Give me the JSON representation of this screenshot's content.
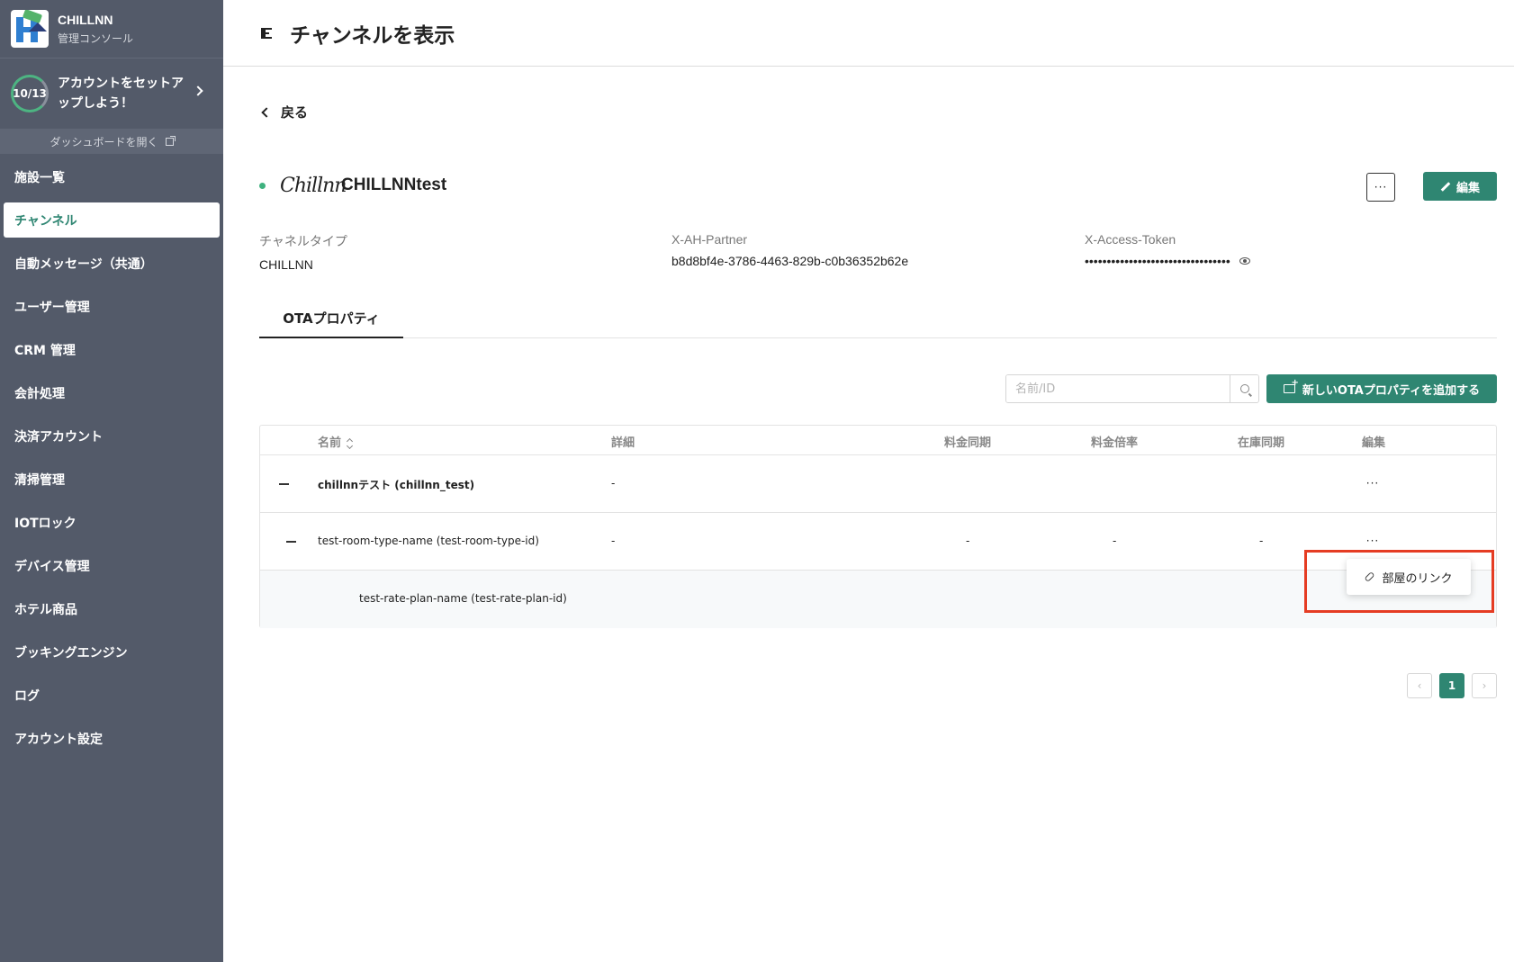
{
  "brand": {
    "name": "CHILLNN",
    "subtitle": "管理コンソール"
  },
  "setup": {
    "progress": "10/13",
    "progress_fraction": 0.77,
    "text": "アカウントをセットアップしよう！",
    "dashboard_link": "ダッシュボードを開く"
  },
  "nav": {
    "items": [
      {
        "label": "施設一覧",
        "active": false
      },
      {
        "label": "チャンネル",
        "active": true
      },
      {
        "label": "自動メッセージ（共通）",
        "active": false
      },
      {
        "label": "ユーザー管理",
        "active": false
      },
      {
        "label": "CRM 管理",
        "active": false
      },
      {
        "label": "会計処理",
        "active": false
      },
      {
        "label": "決済アカウント",
        "active": false
      },
      {
        "label": "清掃管理",
        "active": false
      },
      {
        "label": "IOTロック",
        "active": false
      },
      {
        "label": "デバイス管理",
        "active": false
      },
      {
        "label": "ホテル商品",
        "active": false
      },
      {
        "label": "ブッキングエンジン",
        "active": false
      },
      {
        "label": "ログ",
        "active": false
      },
      {
        "label": "アカウント設定",
        "active": false
      }
    ]
  },
  "header": {
    "title": "チャンネルを表示"
  },
  "back_label": "戻る",
  "channel": {
    "logo_text": "Chillnn",
    "name": "CHILLNNtest",
    "more_label": "···",
    "edit_label": "編集",
    "fields": [
      {
        "label": "チャネルタイプ",
        "value": "CHILLNN"
      },
      {
        "label": "X-AH-Partner",
        "value": "b8d8bf4e-3786-4463-829b-c0b36352b62e"
      },
      {
        "label": "X-Access-Token",
        "value": "•••••••••••••••••••••••••••••••••"
      }
    ]
  },
  "tabs": [
    {
      "label": "OTAプロパティ",
      "active": true
    }
  ],
  "search": {
    "placeholder": "名前/ID",
    "value": ""
  },
  "add_button": "新しいOTAプロパティを追加する",
  "table": {
    "columns": [
      "名前",
      "詳細",
      "料金同期",
      "料金倍率",
      "在庫同期",
      "編集"
    ],
    "rows": [
      {
        "name": "chillnnテスト (chillnn_test)",
        "detail": "-",
        "rate_sync": "",
        "rate_multiplier": "",
        "stock_sync": "",
        "edit": "···"
      },
      {
        "name": "test-room-type-name (test-room-type-id)",
        "detail": "-",
        "rate_sync": "-",
        "rate_multiplier": "-",
        "stock_sync": "-",
        "edit": "···"
      },
      {
        "name": "test-rate-plan-name (test-rate-plan-id)"
      }
    ]
  },
  "popup": {
    "label": "部屋のリンク"
  },
  "pagination": {
    "prev": "‹",
    "current": "1",
    "next": "›"
  },
  "colors": {
    "sidebar": "#535a69",
    "accent": "#2f8672",
    "status": "#3fb27f",
    "highlight": "#e53c23"
  }
}
